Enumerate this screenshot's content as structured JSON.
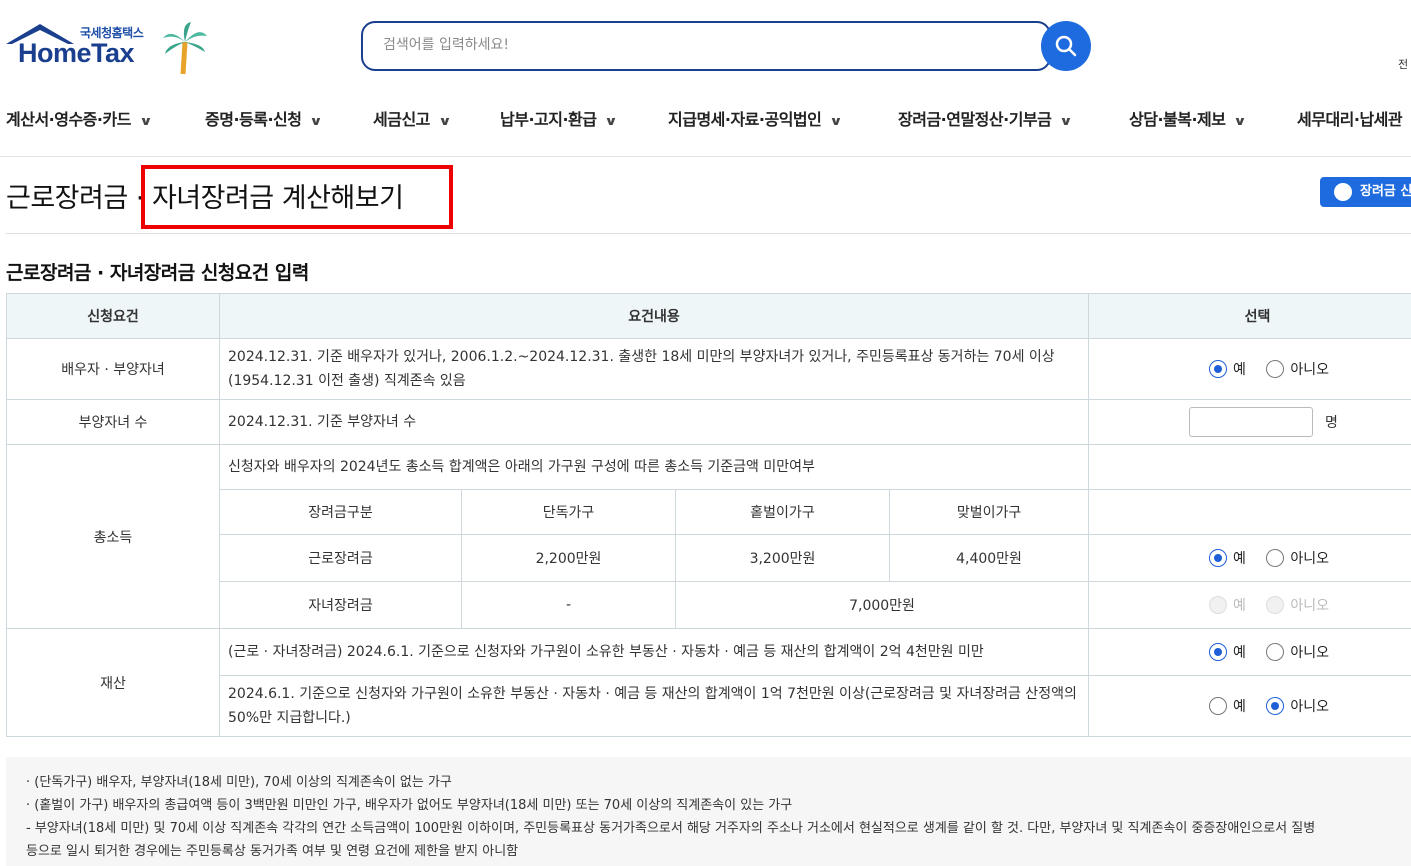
{
  "header": {
    "logo_small": "국세청홈택스",
    "logo_big": "HomeTax",
    "search_placeholder": "검색어를 입력하세요!",
    "corner_text": "전"
  },
  "nav": [
    {
      "label": "계산서·영수증·카드"
    },
    {
      "label": "증명·등록·신청"
    },
    {
      "label": "세금신고"
    },
    {
      "label": "납부·고지·환급"
    },
    {
      "label": "지급명세·자료·공익법인"
    },
    {
      "label": "장려금·연말정산·기부금"
    },
    {
      "label": "상담·불복·제보"
    },
    {
      "label": "세무대리·납세관"
    }
  ],
  "page": {
    "title": "근로장려금 · 자녀장려금 계산해보기",
    "calc_button": "장려금 신",
    "section_title": "근로장려금 · 자녀장려금 신청요건 입력"
  },
  "table": {
    "headers": [
      "신청요건",
      "요건내용",
      "선택"
    ],
    "spouse": {
      "label": "배우자 · 부양자녀",
      "text": "2024.12.31. 기준 배우자가 있거나, 2006.1.2.~2024.12.31. 출생한 18세 미만의 부양자녀가 있거나, 주민등록표상 동거하는 70세 이상(1954.12.31 이전 출생) 직계존속 있음"
    },
    "children": {
      "label": "부양자녀 수",
      "text": "2024.12.31. 기준 부양자녀 수",
      "unit": "명",
      "value": ""
    },
    "income": {
      "label": "총소득",
      "text": "신청자와 배우자의 2024년도 총소득 합계액은 아래의 가구원 구성에 따른 총소득 기준금액 미만여부",
      "sub_headers": [
        "장려금구분",
        "단독가구",
        "홑벌이가구",
        "맞벌이가구"
      ],
      "work_row": [
        "근로장려금",
        "2,200만원",
        "3,200만원",
        "4,400만원"
      ],
      "child_row": [
        "자녀장려금",
        "-",
        "7,000만원"
      ]
    },
    "property": {
      "label": "재산",
      "text1": "(근로 · 자녀장려금) 2024.6.1. 기준으로 신청자와 가구원이 소유한 부동산 · 자동차 · 예금 등 재산의 합계액이 2억 4천만원 미만",
      "text2": "2024.6.1. 기준으로 신청자와 가구원이 소유한 부동산 · 자동차 · 예금 등 재산의 합계액이 1억 7천만원 이상(근로장려금 및 자녀장려금 산정액의 50%만 지급합니다.)"
    },
    "yes": "예",
    "no": "아니오"
  },
  "notes": [
    "· (단독가구) 배우자, 부양자녀(18세 미만), 70세 이상의 직계존속이 없는 가구",
    "· (홑벌이 가구) 배우자의 총급여액 등이 3백만원 미만인 가구, 배우자가 없어도 부양자녀(18세 미만) 또는 70세 이상의 직계존속이 있는 가구",
    "- 부양자녀(18세 미만) 및 70세 이상 직계존속 각각의 연간 소득금액이 100만원 이하이며, 주민등록표상 동거가족으로서 해당 거주자의 주소나 거소에서 현실적으로 생계를 같이 할 것. 다만, 부양자녀 및 직계존속이 중증장애인으로서 질병",
    "등으로 일시 퇴거한 경우에는 주민등록상 동거가족 여부 및 연령 요건에 제한을 받지 아니함"
  ],
  "colors": {
    "brand_blue": "#1e6be0",
    "highlight_red": "#ee0000",
    "header_bg": "#eef6f8"
  }
}
